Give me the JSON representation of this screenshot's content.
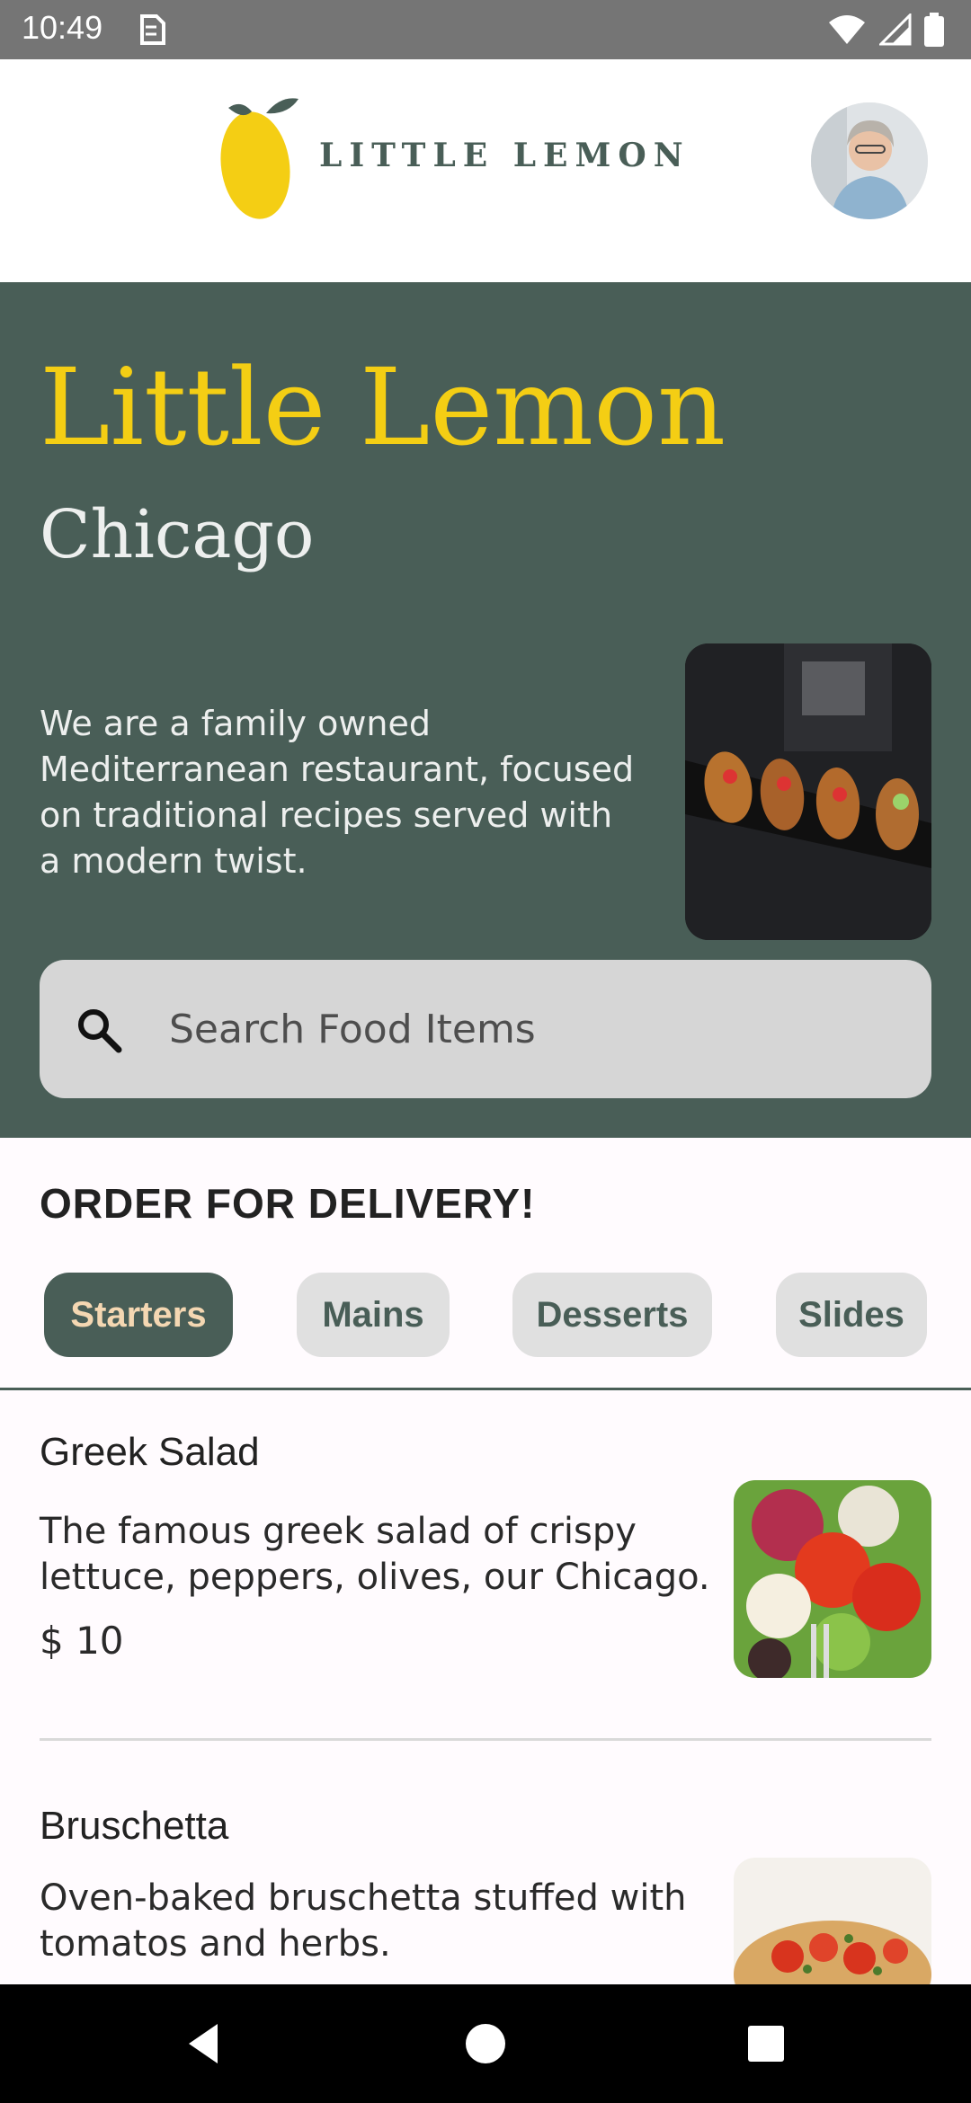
{
  "status_bar": {
    "time": "10:49",
    "icons": [
      "sim-card-icon",
      "wifi-icon",
      "signal-icon",
      "battery-icon"
    ]
  },
  "header": {
    "logo_text": "LITTLE LEMON",
    "avatar_icon": "profile-avatar"
  },
  "hero": {
    "title": "Little Lemon",
    "city": "Chicago",
    "description": "We are a family owned Mediterranean restaurant, focused on traditional recipes served with a modern twist.",
    "search": {
      "placeholder": "Search Food Items",
      "value": ""
    }
  },
  "order": {
    "title": "ORDER FOR DELIVERY!",
    "categories": [
      {
        "label": "Starters",
        "selected": true
      },
      {
        "label": "Mains",
        "selected": false
      },
      {
        "label": "Desserts",
        "selected": false
      },
      {
        "label": "Slides",
        "selected": false
      }
    ]
  },
  "menu": {
    "items": [
      {
        "name": "Greek Salad",
        "description": "The famous greek salad of crispy lettuce, peppers, olives, our Chicago.",
        "price": "$ 10"
      },
      {
        "name": "Bruschetta",
        "description": "Oven-baked bruschetta stuffed with tomatos and herbs.",
        "price": ""
      }
    ]
  },
  "nav_bar": {
    "buttons": [
      "back-icon",
      "home-icon",
      "recents-icon"
    ]
  },
  "colors": {
    "primary_green": "#495E57",
    "primary_yellow": "#F4CE14",
    "chip_active_text": "#F4D7B2",
    "chip_inactive_bg": "#E0E0E0",
    "search_bg": "#D6D6D6"
  }
}
